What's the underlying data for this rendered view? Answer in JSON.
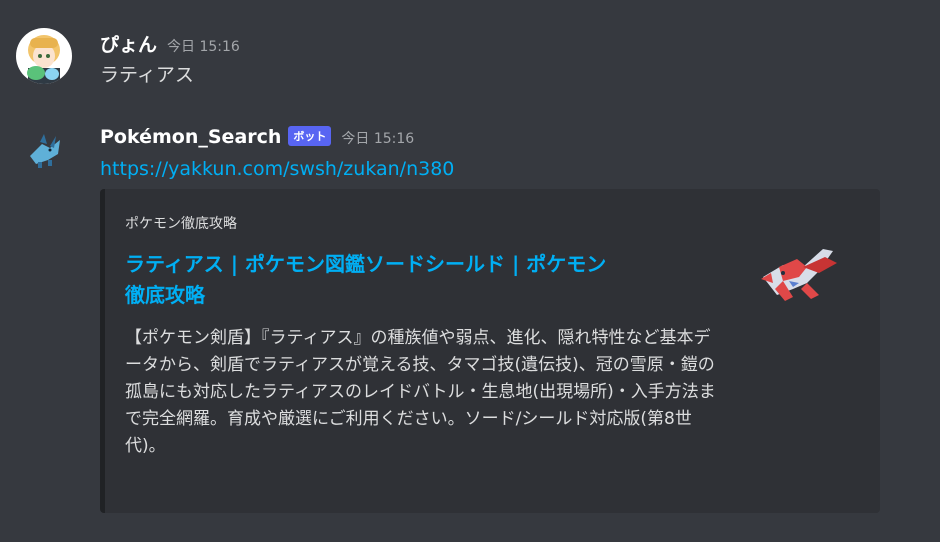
{
  "messages": [
    {
      "username": "ぴょん",
      "timestamp": "今日 15:16",
      "content": "ラティアス"
    },
    {
      "username": "Pokémon_Search",
      "bot_tag": "ボット",
      "timestamp": "今日 15:16",
      "link": "https://yakkun.com/swsh/zukan/n380",
      "embed": {
        "provider": "ポケモン徹底攻略",
        "title_line1": "ラティアス | ポケモン図鑑ソードシールド | ポケモン",
        "title_line2": "徹底攻略",
        "description": "【ポケモン剣盾】『ラティアス』の種族値や弱点、進化、隠れ特性など基本データから、剣盾でラティアスが覚える技、タマゴ技(遺伝技)、冠の雪原・鎧の孤島にも対応したラティアスのレイドバトル・生息地(出現場所)・入手方法まで完全網羅。育成や厳選にご利用ください。ソード/シールド対応版(第8世代)。"
      }
    }
  ],
  "colors": {
    "background": "#36393f",
    "embed_background": "#2f3136",
    "link": "#00aff4",
    "bot_tag": "#5865f2",
    "timestamp": "#a3a6aa"
  },
  "icons": {
    "user_avatar": "user-avatar-icon",
    "bot_avatar": "glaceon-sprite-icon",
    "embed_thumbnail": "latias-sprite-icon"
  }
}
